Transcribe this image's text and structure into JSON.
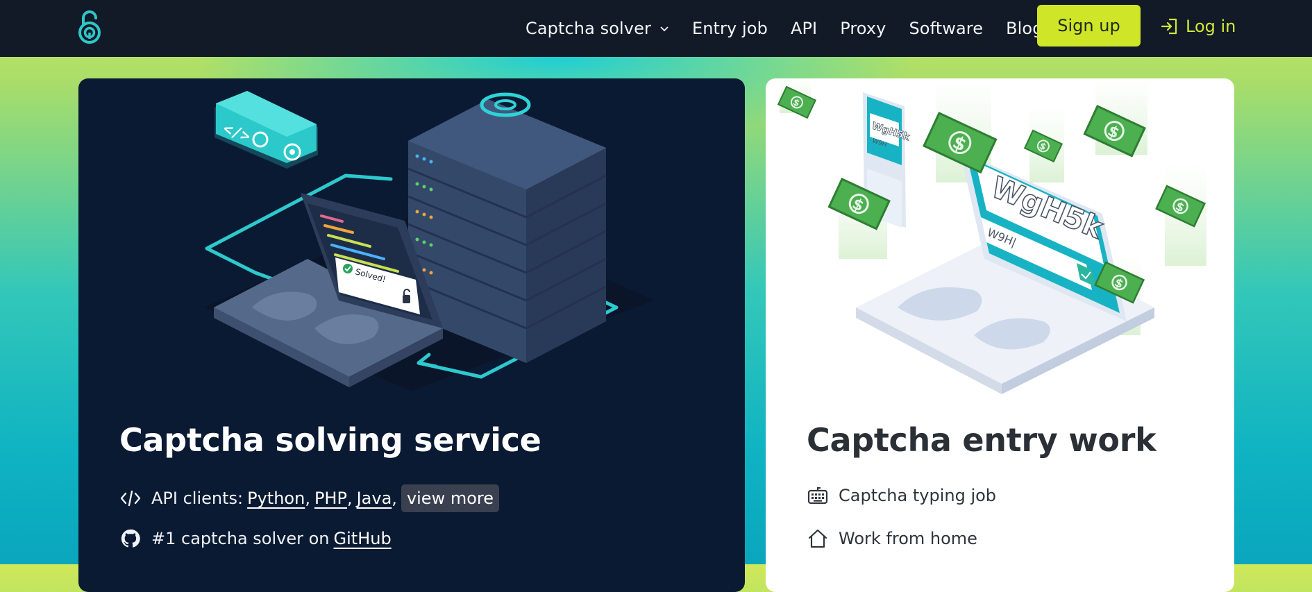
{
  "nav": {
    "items": [
      {
        "label": "Captcha solver",
        "has_dropdown": true
      },
      {
        "label": "Entry job"
      },
      {
        "label": "API"
      },
      {
        "label": "Proxy"
      },
      {
        "label": "Software"
      },
      {
        "label": "Blog"
      }
    ],
    "signup_label": "Sign up",
    "login_label": "Log in"
  },
  "colors": {
    "nav_bg": "#111a26",
    "accent": "#cfe527",
    "dark_card": "#0b1a33",
    "teal": "#2fd3d6"
  },
  "solver_card": {
    "title": "Captcha solving service",
    "illustration": {
      "badge_text": "Solved!"
    },
    "api_clients": {
      "prefix": "API clients:",
      "links": [
        "Python",
        "PHP",
        "Java"
      ],
      "view_more": "view more"
    },
    "github": {
      "prefix": "#1 captcha solver on",
      "link": "GitHub"
    }
  },
  "entry_card": {
    "title": "Captcha entry work",
    "illustration": {
      "captcha_text": "WgH5k",
      "typed_text": "W9H|",
      "phone_captcha": "WgH5k",
      "phone_typed": "W9H"
    },
    "features": [
      {
        "icon": "keyboard-icon",
        "label": "Captcha typing job"
      },
      {
        "icon": "home-icon",
        "label": "Work from home"
      }
    ]
  }
}
